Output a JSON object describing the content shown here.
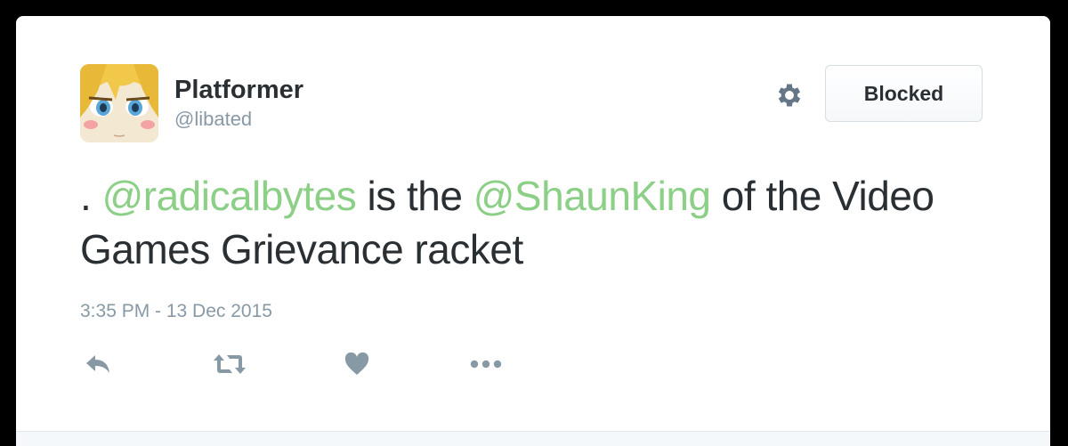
{
  "user": {
    "display_name": "Platformer",
    "handle": "@libated"
  },
  "header": {
    "blocked_label": "Blocked",
    "settings_icon": "gear-icon"
  },
  "tweet": {
    "prefix": ". ",
    "mention_1": "@radicalbytes",
    "middle": " is the ",
    "mention_2": "@ShaunKing",
    "suffix": " of the Video Games Grievance racket",
    "timestamp": "3:35 PM - 13 Dec 2015"
  },
  "actions": {
    "reply_icon": "reply-icon",
    "retweet_icon": "retweet-icon",
    "like_icon": "heart-icon",
    "more_icon": "more-dots-icon"
  },
  "colors": {
    "mention": "#8ccf86",
    "text": "#292f33",
    "muted": "#8899a6",
    "icon": "#8899a6"
  }
}
